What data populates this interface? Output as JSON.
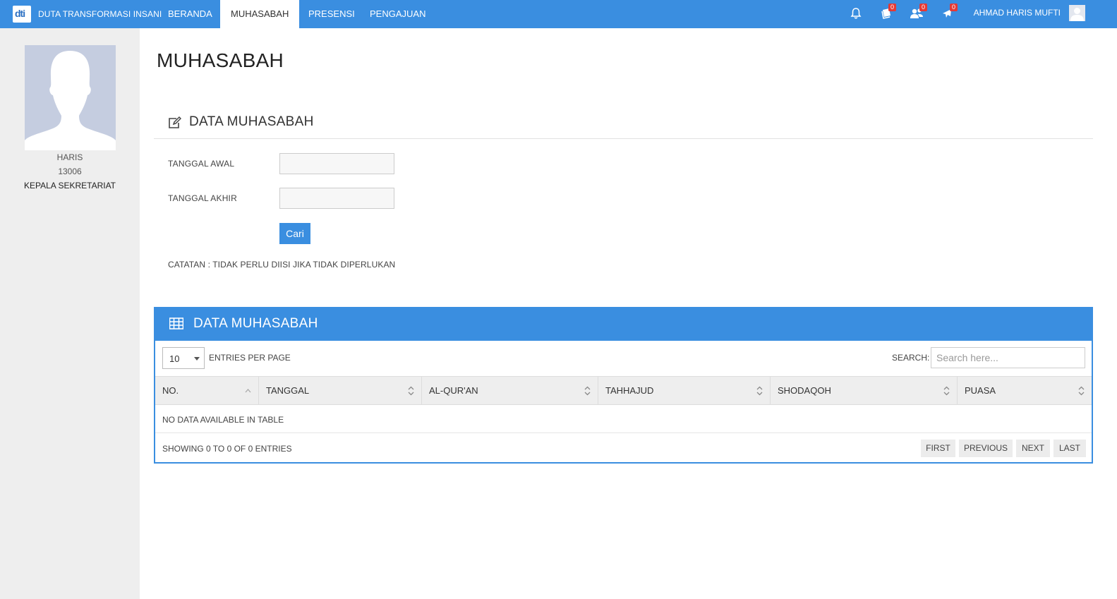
{
  "navbar": {
    "brand": "DUTA TRANSFORMASI INSANI",
    "logo_text": "dti",
    "items": [
      {
        "label": "BERANDA",
        "active": false
      },
      {
        "label": "MUHASABAH",
        "active": true
      },
      {
        "label": "PRESENSI",
        "active": false
      },
      {
        "label": "PENGAJUAN",
        "active": false
      }
    ],
    "icons": [
      {
        "name": "bell-icon",
        "badge": ""
      },
      {
        "name": "book-icon",
        "badge": "0"
      },
      {
        "name": "users-icon",
        "badge": "0"
      },
      {
        "name": "plane-icon",
        "badge": "0"
      }
    ],
    "user_name": "AHMAD HARIS MUFTI"
  },
  "sidebar": {
    "name": "HARIS",
    "id": "13006",
    "role": "KEPALA SEKRETARIAT"
  },
  "page": {
    "title": "MUHASABAH"
  },
  "form": {
    "section_title": "DATA MUHASABAH",
    "start_date_label": "TANGGAL AWAL",
    "start_date_value": "",
    "end_date_label": "TANGGAL AKHIR",
    "end_date_value": "",
    "search_button": "Cari",
    "note": "CATATAN : TIDAK PERLU DIISI JIKA TIDAK DIPERLUKAN"
  },
  "table": {
    "panel_title": "DATA MUHASABAH",
    "entries_value": "10",
    "entries_label": "ENTRIES PER PAGE",
    "search_label": "SEARCH:",
    "search_placeholder": "Search here...",
    "columns": [
      "NO.",
      "TANGGAL",
      "AL-QUR'AN",
      "TAHHAJUD",
      "SHODAQOH",
      "PUASA"
    ],
    "empty_message": "NO DATA AVAILABLE IN TABLE",
    "info": "SHOWING 0 TO 0 OF 0 ENTRIES",
    "pagination": [
      "FIRST",
      "PREVIOUS",
      "NEXT",
      "LAST"
    ]
  },
  "colors": {
    "primary": "#3a8ee0",
    "sidebar_bg": "#eeeeee",
    "badge": "#e53935"
  }
}
